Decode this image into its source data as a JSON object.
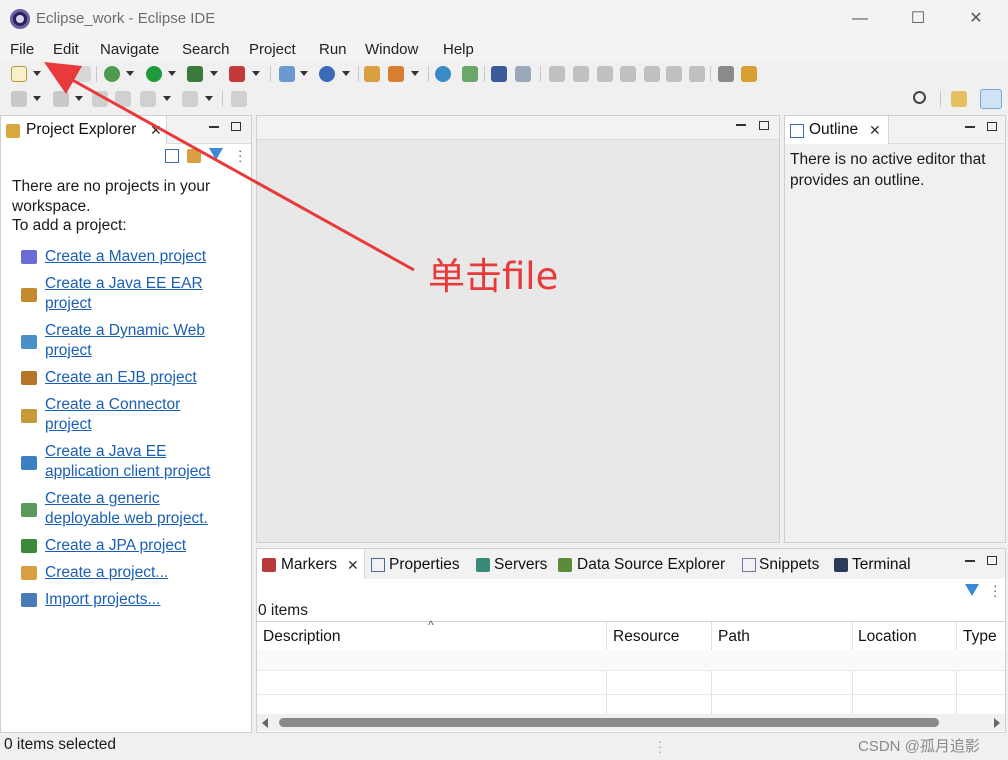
{
  "window": {
    "title": "Eclipse_work - Eclipse IDE",
    "minimize": "—",
    "maximize": "☐",
    "close": "✕"
  },
  "menu": [
    "File",
    "Edit",
    "Navigate",
    "Search",
    "Project",
    "Run",
    "Window",
    "Help"
  ],
  "project_explorer": {
    "tab_label": "Project Explorer",
    "empty_text": "There are no projects in your workspace.",
    "add_text": "To add a project:",
    "links": [
      {
        "label": "Create a Maven project",
        "icon": "maven-project-icon",
        "color": "#6b6bd6"
      },
      {
        "label": "Create a Java EE EAR \nproject",
        "icon": "ear-project-icon",
        "color": "#c48a2c"
      },
      {
        "label": "Create a Dynamic Web \nproject",
        "icon": "web-project-icon",
        "color": "#4a90c8"
      },
      {
        "label": "Create an EJB project",
        "icon": "ejb-project-icon",
        "color": "#b5762a"
      },
      {
        "label": "Create a Connector \nproject",
        "icon": "connector-project-icon",
        "color": "#c99a3a"
      },
      {
        "label": "Create a Java EE \napplication client project",
        "icon": "app-client-project-icon",
        "color": "#3b7fc4"
      },
      {
        "label": "Create a generic \ndeployable web project.",
        "icon": "generic-web-project-icon",
        "color": "#5a9a5a"
      },
      {
        "label": "Create a JPA project",
        "icon": "jpa-project-icon",
        "color": "#3a8a3a"
      },
      {
        "label": "Create a project...",
        "icon": "new-project-icon",
        "color": "#d8a040"
      },
      {
        "label": "Import projects...",
        "icon": "import-projects-icon",
        "color": "#4a7ab8"
      }
    ]
  },
  "outline": {
    "tab_label": "Outline",
    "message": "There is no active editor that provides an outline."
  },
  "annotation": {
    "text": "单击file",
    "color": "#e83a3a"
  },
  "bottom_tabs": [
    "Markers",
    "Properties",
    "Servers",
    "Data Source Explorer",
    "Snippets",
    "Terminal"
  ],
  "markers": {
    "count": "0 items",
    "sort_glyph": "^",
    "columns": [
      "Description",
      "Resource",
      "Path",
      "Location",
      "Type"
    ]
  },
  "status": {
    "selected": "0 items selected",
    "watermark": "CSDN @孤月追影"
  }
}
